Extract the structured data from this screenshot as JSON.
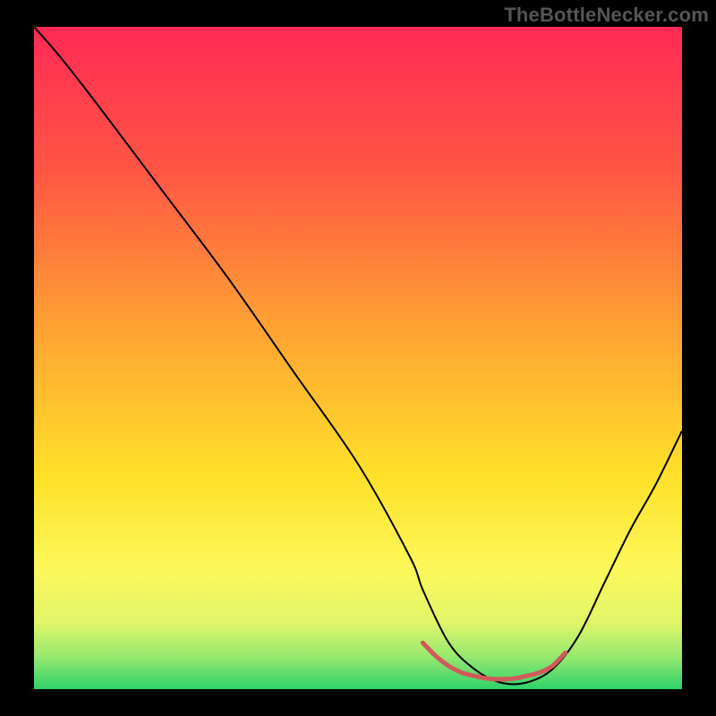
{
  "watermark": "TheBottleNecker.com",
  "chart_data": {
    "type": "line",
    "title": "",
    "xlabel": "",
    "ylabel": "",
    "xlim": [
      0,
      100
    ],
    "ylim": [
      0,
      100
    ],
    "background": {
      "type": "vertical-gradient",
      "stops": [
        {
          "offset": 0.0,
          "color": "#ff2a55"
        },
        {
          "offset": 0.22,
          "color": "#ff5744"
        },
        {
          "offset": 0.45,
          "color": "#ffa133"
        },
        {
          "offset": 0.68,
          "color": "#ffe12a"
        },
        {
          "offset": 0.82,
          "color": "#fdf85b"
        },
        {
          "offset": 0.9,
          "color": "#e0f56a"
        },
        {
          "offset": 0.95,
          "color": "#98e96f"
        },
        {
          "offset": 1.0,
          "color": "#2fd36a"
        }
      ]
    },
    "series": [
      {
        "name": "bottleneck-curve",
        "color": "#000000",
        "width": 2,
        "x": [
          0,
          4,
          10,
          20,
          30,
          40,
          50,
          58,
          60,
          64,
          68,
          72,
          76,
          80,
          84,
          88,
          92,
          96,
          100
        ],
        "y": [
          100,
          95.5,
          88,
          75,
          62,
          48,
          34,
          20,
          15,
          7,
          3,
          1,
          1,
          3,
          8,
          16,
          24,
          31,
          39
        ]
      },
      {
        "name": "sweet-spot",
        "type": "marker-band",
        "color": "#d15a5a",
        "width": 5,
        "x": [
          60,
          62,
          64,
          66,
          68,
          70,
          72,
          74,
          76,
          78,
          80,
          82
        ],
        "y": [
          7,
          5,
          3.5,
          2.5,
          2,
          1.6,
          1.5,
          1.6,
          2,
          2.5,
          3.5,
          5.5
        ]
      }
    ]
  }
}
